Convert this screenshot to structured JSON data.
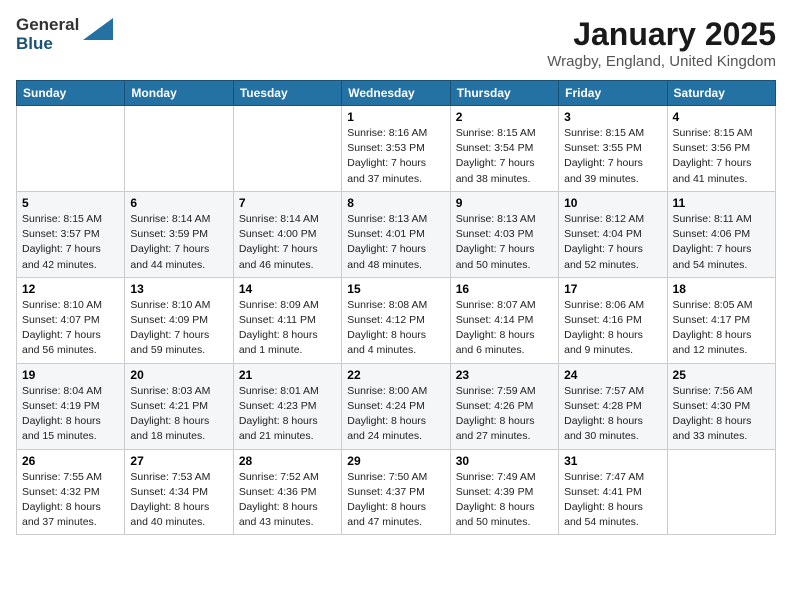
{
  "header": {
    "logo_general": "General",
    "logo_blue": "Blue",
    "month_title": "January 2025",
    "location": "Wragby, England, United Kingdom"
  },
  "weekdays": [
    "Sunday",
    "Monday",
    "Tuesday",
    "Wednesday",
    "Thursday",
    "Friday",
    "Saturday"
  ],
  "weeks": [
    [
      {
        "day": "",
        "info": ""
      },
      {
        "day": "",
        "info": ""
      },
      {
        "day": "",
        "info": ""
      },
      {
        "day": "1",
        "info": "Sunrise: 8:16 AM\nSunset: 3:53 PM\nDaylight: 7 hours and 37 minutes."
      },
      {
        "day": "2",
        "info": "Sunrise: 8:15 AM\nSunset: 3:54 PM\nDaylight: 7 hours and 38 minutes."
      },
      {
        "day": "3",
        "info": "Sunrise: 8:15 AM\nSunset: 3:55 PM\nDaylight: 7 hours and 39 minutes."
      },
      {
        "day": "4",
        "info": "Sunrise: 8:15 AM\nSunset: 3:56 PM\nDaylight: 7 hours and 41 minutes."
      }
    ],
    [
      {
        "day": "5",
        "info": "Sunrise: 8:15 AM\nSunset: 3:57 PM\nDaylight: 7 hours and 42 minutes."
      },
      {
        "day": "6",
        "info": "Sunrise: 8:14 AM\nSunset: 3:59 PM\nDaylight: 7 hours and 44 minutes."
      },
      {
        "day": "7",
        "info": "Sunrise: 8:14 AM\nSunset: 4:00 PM\nDaylight: 7 hours and 46 minutes."
      },
      {
        "day": "8",
        "info": "Sunrise: 8:13 AM\nSunset: 4:01 PM\nDaylight: 7 hours and 48 minutes."
      },
      {
        "day": "9",
        "info": "Sunrise: 8:13 AM\nSunset: 4:03 PM\nDaylight: 7 hours and 50 minutes."
      },
      {
        "day": "10",
        "info": "Sunrise: 8:12 AM\nSunset: 4:04 PM\nDaylight: 7 hours and 52 minutes."
      },
      {
        "day": "11",
        "info": "Sunrise: 8:11 AM\nSunset: 4:06 PM\nDaylight: 7 hours and 54 minutes."
      }
    ],
    [
      {
        "day": "12",
        "info": "Sunrise: 8:10 AM\nSunset: 4:07 PM\nDaylight: 7 hours and 56 minutes."
      },
      {
        "day": "13",
        "info": "Sunrise: 8:10 AM\nSunset: 4:09 PM\nDaylight: 7 hours and 59 minutes."
      },
      {
        "day": "14",
        "info": "Sunrise: 8:09 AM\nSunset: 4:11 PM\nDaylight: 8 hours and 1 minute."
      },
      {
        "day": "15",
        "info": "Sunrise: 8:08 AM\nSunset: 4:12 PM\nDaylight: 8 hours and 4 minutes."
      },
      {
        "day": "16",
        "info": "Sunrise: 8:07 AM\nSunset: 4:14 PM\nDaylight: 8 hours and 6 minutes."
      },
      {
        "day": "17",
        "info": "Sunrise: 8:06 AM\nSunset: 4:16 PM\nDaylight: 8 hours and 9 minutes."
      },
      {
        "day": "18",
        "info": "Sunrise: 8:05 AM\nSunset: 4:17 PM\nDaylight: 8 hours and 12 minutes."
      }
    ],
    [
      {
        "day": "19",
        "info": "Sunrise: 8:04 AM\nSunset: 4:19 PM\nDaylight: 8 hours and 15 minutes."
      },
      {
        "day": "20",
        "info": "Sunrise: 8:03 AM\nSunset: 4:21 PM\nDaylight: 8 hours and 18 minutes."
      },
      {
        "day": "21",
        "info": "Sunrise: 8:01 AM\nSunset: 4:23 PM\nDaylight: 8 hours and 21 minutes."
      },
      {
        "day": "22",
        "info": "Sunrise: 8:00 AM\nSunset: 4:24 PM\nDaylight: 8 hours and 24 minutes."
      },
      {
        "day": "23",
        "info": "Sunrise: 7:59 AM\nSunset: 4:26 PM\nDaylight: 8 hours and 27 minutes."
      },
      {
        "day": "24",
        "info": "Sunrise: 7:57 AM\nSunset: 4:28 PM\nDaylight: 8 hours and 30 minutes."
      },
      {
        "day": "25",
        "info": "Sunrise: 7:56 AM\nSunset: 4:30 PM\nDaylight: 8 hours and 33 minutes."
      }
    ],
    [
      {
        "day": "26",
        "info": "Sunrise: 7:55 AM\nSunset: 4:32 PM\nDaylight: 8 hours and 37 minutes."
      },
      {
        "day": "27",
        "info": "Sunrise: 7:53 AM\nSunset: 4:34 PM\nDaylight: 8 hours and 40 minutes."
      },
      {
        "day": "28",
        "info": "Sunrise: 7:52 AM\nSunset: 4:36 PM\nDaylight: 8 hours and 43 minutes."
      },
      {
        "day": "29",
        "info": "Sunrise: 7:50 AM\nSunset: 4:37 PM\nDaylight: 8 hours and 47 minutes."
      },
      {
        "day": "30",
        "info": "Sunrise: 7:49 AM\nSunset: 4:39 PM\nDaylight: 8 hours and 50 minutes."
      },
      {
        "day": "31",
        "info": "Sunrise: 7:47 AM\nSunset: 4:41 PM\nDaylight: 8 hours and 54 minutes."
      },
      {
        "day": "",
        "info": ""
      }
    ]
  ]
}
